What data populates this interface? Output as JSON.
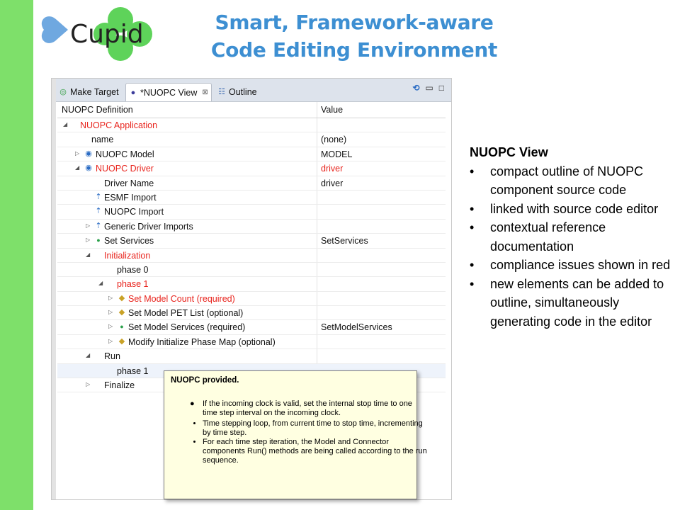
{
  "logo": {
    "text": "Cupid",
    "heart_color": "#6fa8e0",
    "clover_color": "#5ed35a",
    "icon": "cupid-logo-icon"
  },
  "slide": {
    "title_line1": "Smart, Framework-aware",
    "title_line2": "Code Editing Environment",
    "accent_color": "#3d8fd2",
    "bar_color": "#7ee06a"
  },
  "tabs": [
    {
      "label": "Make Target",
      "icon": "make-target-icon"
    },
    {
      "label": "*NUOPC View",
      "icon": "nuopc-view-icon",
      "close": "⊠"
    },
    {
      "label": "Outline",
      "icon": "outline-icon"
    }
  ],
  "tree": {
    "col_definition": "NUOPC Definition",
    "col_value": "Value",
    "rows": [
      {
        "label": "NUOPC Application",
        "value": ""
      },
      {
        "label": "name",
        "value": "(none)"
      },
      {
        "label": "NUOPC Model",
        "value": "MODEL"
      },
      {
        "label": "NUOPC Driver",
        "value": "driver"
      },
      {
        "label": "Driver Name",
        "value": "driver"
      },
      {
        "label": "ESMF Import",
        "value": ""
      },
      {
        "label": "NUOPC Import",
        "value": ""
      },
      {
        "label": "Generic Driver Imports",
        "value": ""
      },
      {
        "label": "Set Services",
        "value": "SetServices"
      },
      {
        "label": "Initialization",
        "value": ""
      },
      {
        "label": "phase 0",
        "value": ""
      },
      {
        "label": "phase 1",
        "value": ""
      },
      {
        "label": "Set Model Count (required)",
        "value": ""
      },
      {
        "label": "Set Model PET List (optional)",
        "value": ""
      },
      {
        "label": "Set Model Services (required)",
        "value": "SetModelServices"
      },
      {
        "label": "Modify Initialize Phase Map (optional)",
        "value": ""
      },
      {
        "label": "Run",
        "value": ""
      },
      {
        "label": "phase 1",
        "value": ""
      },
      {
        "label": "Finalize",
        "value": ""
      }
    ],
    "error_color": "#e8231c"
  },
  "tooltip": {
    "title": "NUOPC provided.",
    "lead": "If the incoming clock is valid, set the internal stop time to one time step interval on the incoming clock.",
    "bullets": [
      "Time stepping loop, from current time to stop time, incrementing by time step.",
      "For each time step iteration, the Model and Connector components Run() methods are being called according to the run sequence."
    ]
  },
  "side_panel": {
    "heading": "NUOPC View",
    "bullets": [
      "compact outline of NUOPC component source code",
      "linked with source code editor",
      "contextual reference documentation",
      "compliance issues shown in red",
      "new elements can be added to outline, simultaneously generating code in the editor"
    ]
  }
}
